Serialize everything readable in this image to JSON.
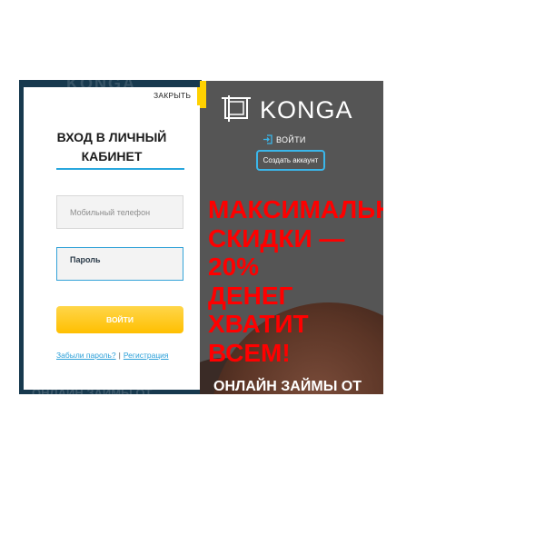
{
  "modal": {
    "close_label": "ЗАКРЫТЬ",
    "title_line1": "ВХОД В ЛИЧНЫЙ",
    "title_line2": "КАБИНЕТ",
    "phone_placeholder": "Мобильный телефон",
    "password_placeholder": "Пароль",
    "login_button": "ВОЙТИ",
    "forgot_password_link": "Забыли пароль?",
    "separator": "|",
    "register_link": "Регистрация",
    "background_brand_ghost": "KONGA",
    "background_promo_ghost": "ОНЛАЙН ЗАЙМЫ ОТ"
  },
  "promo": {
    "logo_text": "KONGA",
    "login_link": "ВОЙТИ",
    "create_account_button": "Создать аккаунт",
    "headline_lines": [
      "МАКСИМАЛЬН",
      "СКИДКИ —",
      "20%",
      "ДЕНЕГ",
      "ХВАТИТ",
      "ВСЕМ!"
    ],
    "subheadline": "ОНЛАЙН ЗАЙМЫ ОТ"
  },
  "colors": {
    "accent_yellow": "#ffd100",
    "accent_blue": "#29a7dd",
    "headline_red": "#ff0000",
    "promo_bg": "#555555",
    "frame_navy": "#17394e"
  },
  "icons": {
    "logo_mark": "square-frame-icon",
    "login_link_icon": "login-arrow-icon"
  }
}
